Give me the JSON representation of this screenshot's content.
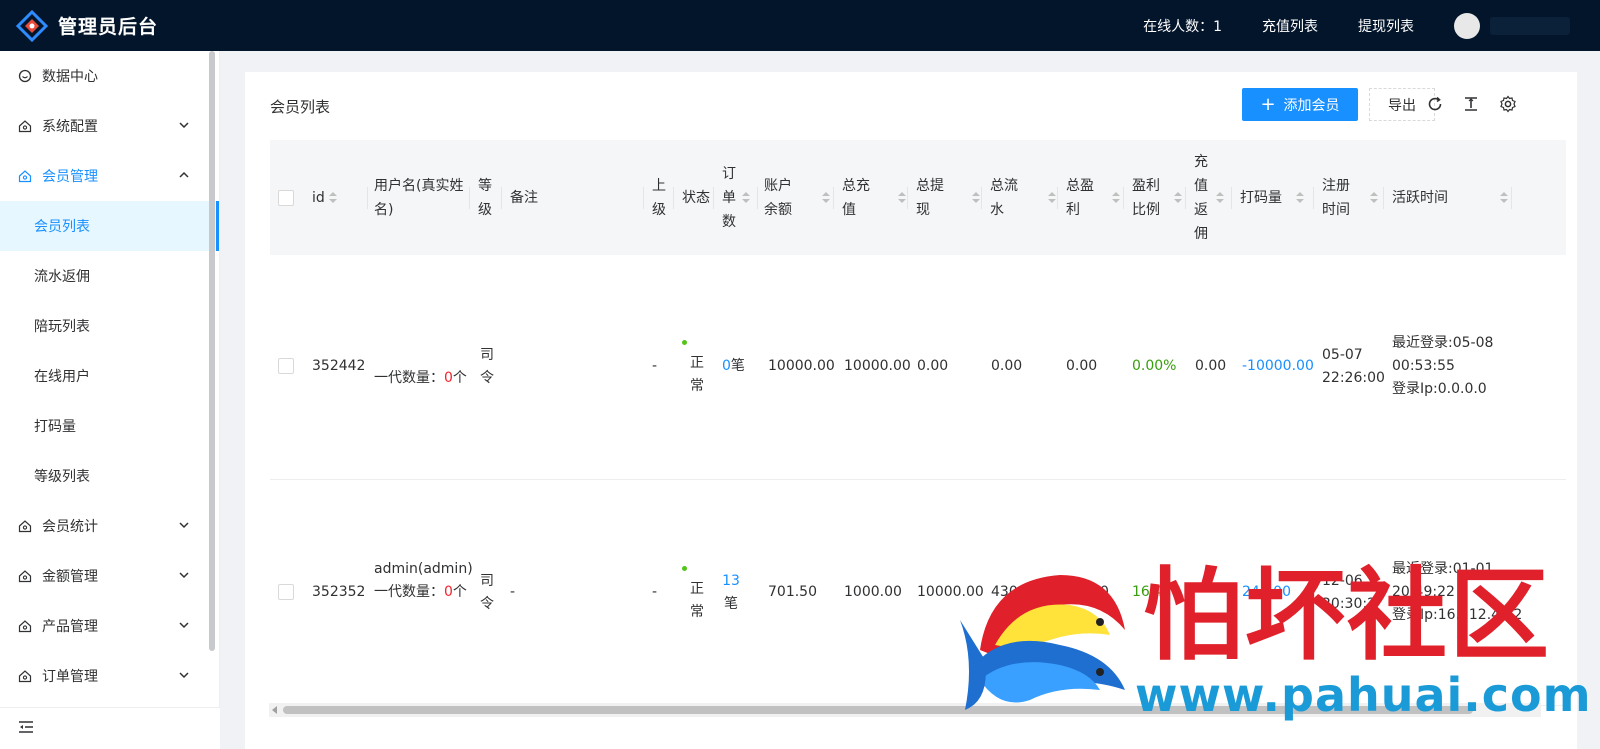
{
  "header": {
    "title": "管理员后台",
    "online_label": "在线人数：1",
    "recharge_link": "充值列表",
    "withdraw_link": "提现列表"
  },
  "sidebar": {
    "items": [
      {
        "label": "数据中心",
        "icon": "dashboard-icon"
      },
      {
        "label": "系统配置",
        "icon": "home-icon",
        "expandable": true
      },
      {
        "label": "会员管理",
        "icon": "home-icon",
        "expandable": true,
        "open": true,
        "children": [
          "会员列表",
          "流水返佣",
          "陪玩列表",
          "在线用户",
          "打码量",
          "等级列表"
        ]
      },
      {
        "label": "会员统计",
        "icon": "home-icon",
        "expandable": true
      },
      {
        "label": "金额管理",
        "icon": "home-icon",
        "expandable": true
      },
      {
        "label": "产品管理",
        "icon": "home-icon",
        "expandable": true
      },
      {
        "label": "订单管理",
        "icon": "home-icon",
        "expandable": true
      }
    ],
    "active": "会员列表"
  },
  "panel": {
    "title": "会员列表",
    "add_button": "添加会员",
    "export_button": "导出"
  },
  "table": {
    "columns": [
      {
        "key": "id",
        "label": "id"
      },
      {
        "key": "username",
        "label": "用户名(真实姓名)"
      },
      {
        "key": "level",
        "label": "等级"
      },
      {
        "key": "remark",
        "label": "备注"
      },
      {
        "key": "parent",
        "label": "上级"
      },
      {
        "key": "status",
        "label": "状态"
      },
      {
        "key": "orders",
        "label": "订单数"
      },
      {
        "key": "balance",
        "label": "账户余额"
      },
      {
        "key": "total_recharge",
        "label": "总充值"
      },
      {
        "key": "total_withdraw",
        "label": "总提现"
      },
      {
        "key": "total_flow",
        "label": "总流水"
      },
      {
        "key": "total_profit",
        "label": "总盈利"
      },
      {
        "key": "profit_ratio",
        "label": "盈利比例"
      },
      {
        "key": "recharge_rebate",
        "label": "充值返佣"
      },
      {
        "key": "code_amount",
        "label": "打码量"
      },
      {
        "key": "register_time",
        "label": "注册时间"
      },
      {
        "key": "active_time",
        "label": "活跃时间"
      }
    ],
    "rows": [
      {
        "id": "352442",
        "username_line1": "",
        "sub_count_label": "一代数量：",
        "sub_count": "0",
        "sub_unit": "个",
        "level": "司令",
        "remark": "",
        "parent": "-",
        "status": "正常",
        "orders_num": "0",
        "orders_unit": "笔",
        "balance": "10000.00",
        "total_recharge": "10000.00",
        "total_withdraw": "0.00",
        "total_flow": "0.00",
        "total_profit": "0.00",
        "profit_ratio": "0.00%",
        "recharge_rebate": "0.00",
        "code_amount": "-10000.00",
        "register_time_1": "05-07",
        "register_time_2": "22:26:00",
        "active_1": "最近登录:05-08",
        "active_2": "00:53:55",
        "active_3": "登录Ip:0.0.0.0"
      },
      {
        "id": "352352",
        "username_line1": "admin(admin)",
        "sub_count_label": "一代数量：",
        "sub_count": "0",
        "sub_unit": "个",
        "level": "司令",
        "remark": "-",
        "parent": "-",
        "status": "正常",
        "orders_num": "13",
        "orders_unit": "笔",
        "balance": "701.50",
        "total_recharge": "1000.00",
        "total_withdraw": "10000.00",
        "total_flow": "430",
        "total_profit": "0",
        "profit_ratio": "16.4",
        "recharge_rebate": "",
        "code_amount": "243.00",
        "register_time_1": "12-06",
        "register_time_2": "20:30:2",
        "active_1": "最近登录:01-01",
        "active_2": "20:49:22",
        "active_3": "登录Ip:16.212.49.2"
      }
    ]
  },
  "watermark": {
    "text": "怕坏社区",
    "url": "www.pahuai.com"
  },
  "colors": {
    "topbar": "#03152b",
    "accent": "#1890ff",
    "danger": "#f5222d",
    "success": "#389e0d"
  }
}
